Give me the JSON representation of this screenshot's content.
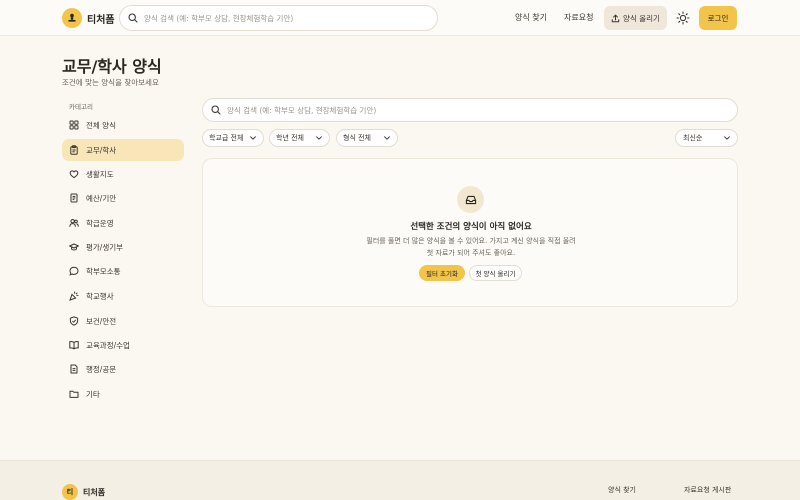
{
  "brand": {
    "name": "티처폼",
    "footer_badge": "티"
  },
  "header": {
    "search_placeholder": "양식 검색 (예: 학부모 상담, 현장체험학습 기안)",
    "nav": {
      "find": "양식 찾기",
      "request": "자료요청"
    },
    "upload_label": "양식 올리기",
    "login_label": "로그인"
  },
  "page": {
    "title": "교무/학사 양식",
    "subtitle": "조건에 맞는 양식을 찾아보세요"
  },
  "sidebar": {
    "category_label": "카테고리",
    "items": [
      {
        "label": "전체 양식",
        "icon": "grid-icon"
      },
      {
        "label": "교무/학사",
        "icon": "clipboard-icon",
        "active": true
      },
      {
        "label": "생활지도",
        "icon": "heart-icon"
      },
      {
        "label": "예산/기안",
        "icon": "receipt-icon"
      },
      {
        "label": "학급운영",
        "icon": "users-icon"
      },
      {
        "label": "평가/생기부",
        "icon": "graduation-cap-icon"
      },
      {
        "label": "학부모소통",
        "icon": "chat-icon"
      },
      {
        "label": "학교행사",
        "icon": "party-icon"
      },
      {
        "label": "보건/안전",
        "icon": "shield-icon"
      },
      {
        "label": "교육과정/수업",
        "icon": "book-icon"
      },
      {
        "label": "행정/공문",
        "icon": "document-icon"
      },
      {
        "label": "기타",
        "icon": "folder-icon"
      }
    ]
  },
  "main": {
    "search_placeholder": "양식 검색 (예: 학부모 상담, 현장체험학습 기안)",
    "filters": {
      "school_level": "학교급 전체",
      "grade": "학년 전체",
      "format": "형식 전체",
      "sort": "최신순"
    },
    "empty": {
      "title": "선택한 조건의 양식이 아직 없어요",
      "description": "필터를 풀면 더 많은 양식을 볼 수 있어요. 가지고 계신 양식을 직접 올려 첫 자료가 되어 주셔도 좋아요.",
      "reset_label": "필터 초기화",
      "upload_label": "첫 양식 올리기"
    }
  },
  "footer": {
    "links": {
      "find": "양식 찾기",
      "board": "자료요청 게시판"
    }
  },
  "colors": {
    "accent": "#f2c44a",
    "active_bg": "#f8e6b8",
    "background": "#fbf8f2"
  }
}
